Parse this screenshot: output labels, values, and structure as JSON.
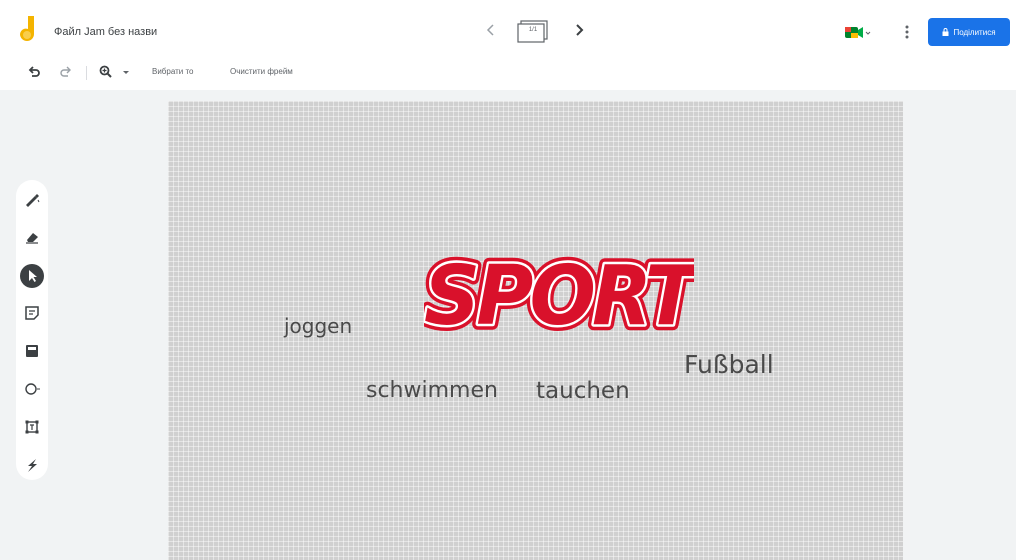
{
  "header": {
    "file_title": "Файл Jam без назви",
    "frame_number": "1/1",
    "share_label": "Поділитися"
  },
  "toolbar": {
    "select_all_label": "Вибрати то",
    "clear_frame_label": "Очистити фрейм"
  },
  "side_tools": [
    "pen-icon",
    "eraser-icon",
    "select-icon",
    "sticky-note-icon",
    "image-icon",
    "shape-icon",
    "text-box-icon",
    "laser-icon"
  ],
  "canvas": {
    "logo_text": "SPORT",
    "words": {
      "joggen": "joggen",
      "schwimmen": "schwimmen",
      "tauchen": "tauchen",
      "fussball": "Fußball"
    }
  },
  "colors": {
    "accent": "#1a73e8",
    "logo_red": "#d9112b",
    "canvas_bg": "#d0d0d0"
  }
}
